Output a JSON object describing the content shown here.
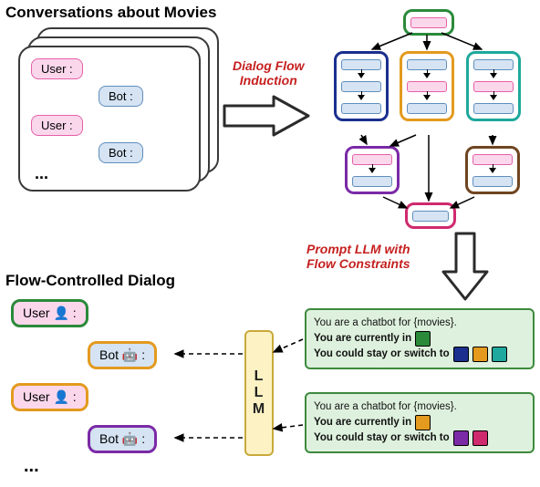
{
  "titles": {
    "top_left": "Conversations about Movies",
    "bottom_left": "Flow-Controlled Dialog"
  },
  "red_labels": {
    "flow_induction_l1": "Dialog Flow",
    "flow_induction_l2": "Induction",
    "prompt_l1": "Prompt LLM with",
    "prompt_l2": "Flow Constraints"
  },
  "conversation": {
    "user": "User :",
    "bot": "Bot :",
    "ellipsis": "..."
  },
  "flow_controlled": {
    "user": "User 👤 :",
    "bot": "Bot 🤖 :",
    "ellipsis": "..."
  },
  "llm": {
    "l1": "L",
    "l2": "L",
    "l3": "M"
  },
  "prompt_box_a": {
    "line1": "You are a chatbot for {movies}.",
    "line2_prefix": "You are currently in",
    "line3_prefix": "You could stay or switch to"
  },
  "prompt_box_b": {
    "line1": "You are a chatbot for {movies}.",
    "line2_prefix": "You are currently in",
    "line3_prefix": "You could stay or switch to"
  },
  "colors": {
    "green": "#2a8a3a",
    "navy": "#1a2f8e",
    "orange": "#e39a1f",
    "teal": "#1fa89d",
    "purple": "#7b2aa6",
    "brown": "#6f4520",
    "pink": "#cf2a6e",
    "pink_fill": "#fbd7ec",
    "blue_fill": "#d5e3f3"
  },
  "chart_data": {
    "type": "diagram",
    "nodes": [
      {
        "id": "start",
        "border": "green",
        "turns": [
          "pink"
        ]
      },
      {
        "id": "navy",
        "border": "navy",
        "turns": [
          "blue",
          "blue",
          "blue"
        ]
      },
      {
        "id": "orange",
        "border": "orange",
        "turns": [
          "blue",
          "pink",
          "blue"
        ]
      },
      {
        "id": "teal",
        "border": "teal",
        "turns": [
          "blue",
          "pink",
          "blue"
        ]
      },
      {
        "id": "purple",
        "border": "purple",
        "turns": [
          "pink",
          "blue"
        ]
      },
      {
        "id": "brown",
        "border": "brown",
        "turns": [
          "pink",
          "blue"
        ]
      },
      {
        "id": "end",
        "border": "pink",
        "turns": [
          "blue"
        ]
      }
    ],
    "edges": [
      [
        "start",
        "navy"
      ],
      [
        "start",
        "orange"
      ],
      [
        "start",
        "teal"
      ],
      [
        "navy",
        "purple"
      ],
      [
        "orange",
        "purple"
      ],
      [
        "teal",
        "brown"
      ],
      [
        "orange",
        "end"
      ],
      [
        "purple",
        "end"
      ],
      [
        "brown",
        "end"
      ]
    ],
    "flow_dialog_sequence": [
      "green-user",
      "orange-bot",
      "orange-user",
      "purple-bot"
    ],
    "prompt_a_swatches": {
      "current": "green",
      "options": [
        "navy",
        "orange",
        "teal"
      ]
    },
    "prompt_b_swatches": {
      "current": "orange",
      "options": [
        "purple",
        "pink"
      ]
    }
  }
}
